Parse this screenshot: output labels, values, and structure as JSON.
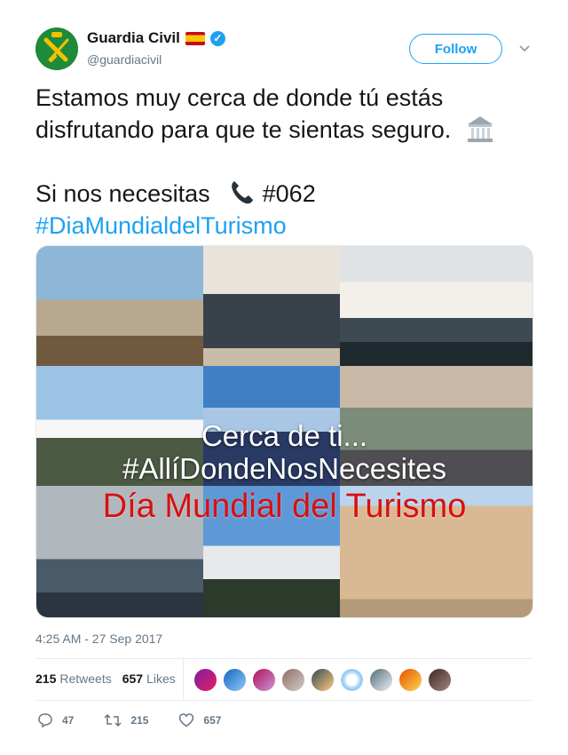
{
  "user": {
    "name": "Guardia Civil",
    "handle": "@guardiacivil",
    "follow_label": "Follow",
    "avatar_icon": "guardia-civil-emblem-icon",
    "flag_icon": "spain-flag-icon",
    "verified_icon": "verified-badge-icon"
  },
  "tweet": {
    "line1": "Estamos muy cerca de donde tú estás",
    "line2": "disfrutando para que te sientas seguro.",
    "line4a": "Si nos necesitas",
    "line4b": "#062",
    "hashtag": "#DiaMundialdelTurismo",
    "emoji_icons": [
      "classical-building-icon",
      "train-icon",
      "hotel-icon",
      "ship-icon",
      "church-icon",
      "stadium-icon",
      "national-park-icon",
      "railway-car-icon",
      "post-office-icon",
      "telephone-receiver-icon"
    ]
  },
  "media": {
    "overlay_line1": "Cerca de ti...",
    "overlay_line2": "#AllíDondeNosNecesites",
    "overlay_line3": "Día Mundial del Turismo"
  },
  "timestamp": "4:25 AM - 27 Sep 2017",
  "stats": {
    "retweets_count": "215",
    "retweets_label": "Retweets",
    "likes_count": "657",
    "likes_label": "Likes"
  },
  "likers_count": 9,
  "actions": {
    "replies": "47",
    "retweets": "215",
    "likes": "657"
  }
}
